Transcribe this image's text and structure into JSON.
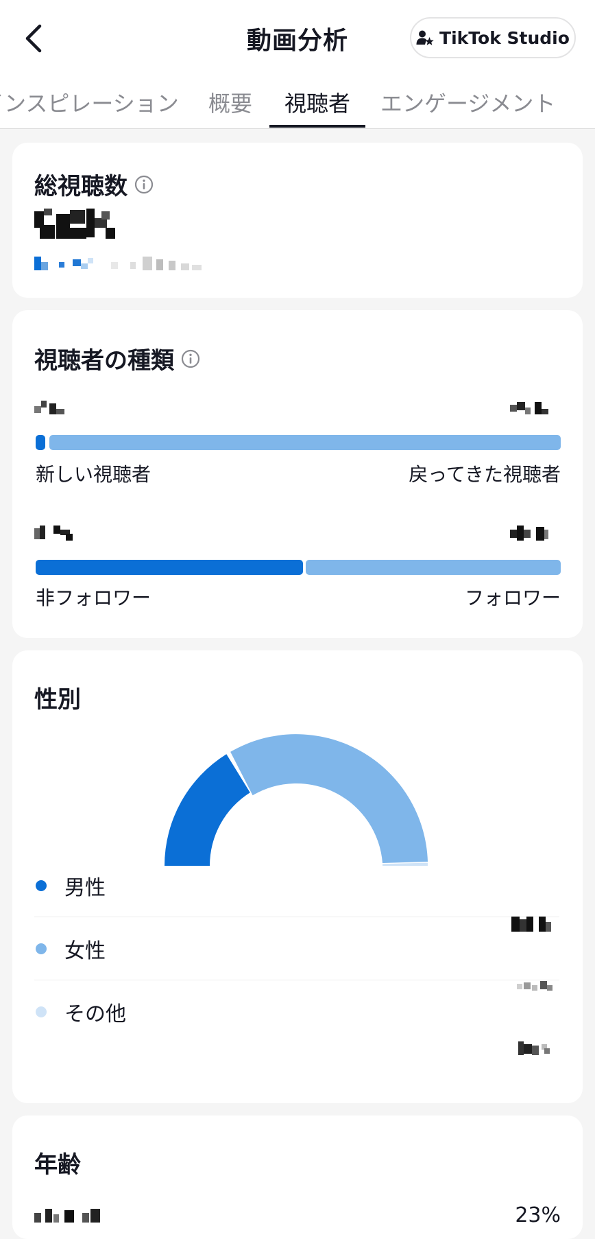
{
  "header": {
    "title": "動画分析",
    "studio_button_label": "TikTok Studio"
  },
  "tabs": [
    {
      "label": "インスピレーション",
      "active": false
    },
    {
      "label": "概要",
      "active": false
    },
    {
      "label": "視聴者",
      "active": true
    },
    {
      "label": "エンゲージメント",
      "active": false
    }
  ],
  "total_views": {
    "title": "総視聴数"
  },
  "viewer_types": {
    "title": "視聴者の種類",
    "row1": {
      "left_label": "新しい視聴者",
      "right_label": "戻ってきた視聴者"
    },
    "row2": {
      "left_label": "非フォロワー",
      "right_label": "フォロワー"
    }
  },
  "gender": {
    "title": "性別",
    "items": [
      {
        "label": "男性",
        "color": "#0b6fd6"
      },
      {
        "label": "女性",
        "color": "#7fb6ea"
      },
      {
        "label": "その他",
        "color": "#cfe3f7"
      }
    ]
  },
  "age": {
    "title": "年齢",
    "first_value": "23%"
  },
  "colors": {
    "primary_blue": "#0b6fd6",
    "light_blue": "#7fb6ea",
    "pale_blue": "#cfe3f7"
  }
}
